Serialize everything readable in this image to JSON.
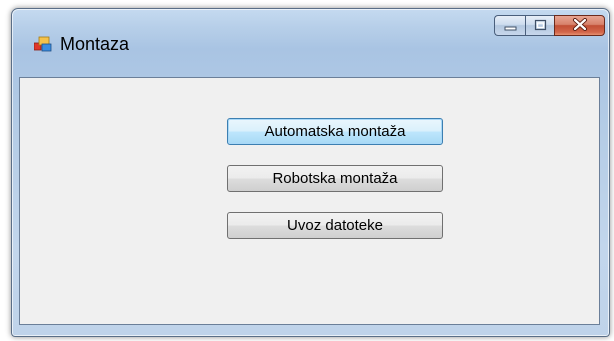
{
  "window": {
    "title": "Montaza",
    "icon": "windows-form-icon",
    "controls": [
      "minimize-icon",
      "maximize-icon",
      "close-icon"
    ]
  },
  "buttons": {
    "automatska": "Automatska montaža",
    "robotska": "Robotska montaža",
    "uvoz": "Uvoz datoteke"
  },
  "colors": {
    "client_bg": "#f0f0f0",
    "close_red": "#c14f35",
    "focus_blue": "#3c7fb1"
  }
}
